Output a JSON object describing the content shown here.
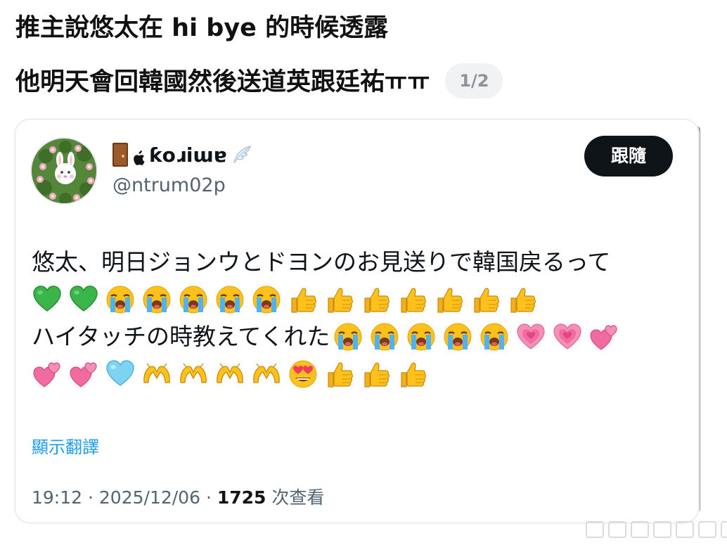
{
  "caption": {
    "line1": "推主說悠太在 hi bye 的時候透露",
    "line2": "他明天會回韓國然後送道英跟廷祐ㅠㅠ",
    "page_indicator": "1/2"
  },
  "tweet": {
    "display_name": "ƙoɹiɯɐ",
    "handle": "@ntrum02p",
    "follow_label": "跟隨",
    "text_line1": "悠太、明日ジョンウとドヨンのお見送りで韓国戻るって",
    "text_line3": "ハイタッチの時教えてくれた",
    "emoji_row2": [
      "green-heart",
      "green-heart",
      "loudly-crying",
      "loudly-crying",
      "loudly-crying",
      "loudly-crying",
      "loudly-crying",
      "thumbs-up",
      "thumbs-up",
      "thumbs-up",
      "thumbs-up",
      "thumbs-up",
      "thumbs-up",
      "thumbs-up"
    ],
    "emoji_row3": [
      "loudly-crying",
      "loudly-crying",
      "loudly-crying",
      "loudly-crying",
      "loudly-crying",
      "growing-heart",
      "growing-heart",
      "two-hearts"
    ],
    "emoji_row4": [
      "two-hearts",
      "two-hearts",
      "light-blue-heart",
      "heart-hands",
      "heart-hands",
      "heart-hands",
      "heart-hands",
      "heart-eyes",
      "thumbs-up",
      "thumbs-up",
      "thumbs-up"
    ],
    "translate_label": "顯示翻譯",
    "time": "19:12",
    "date": "2025/12/06",
    "separator": "·",
    "views_count": "1725",
    "views_label": "次查看"
  },
  "icons": {
    "display_name_prefix": "door-icon",
    "display_name_apple": "apple-icon",
    "display_name_suffix": "wing-icon"
  },
  "colors": {
    "follow_button_bg": "#0f1419",
    "link_blue": "#1d9bf0",
    "secondary_text": "#536471",
    "badge_bg": "#f1f2f4"
  }
}
